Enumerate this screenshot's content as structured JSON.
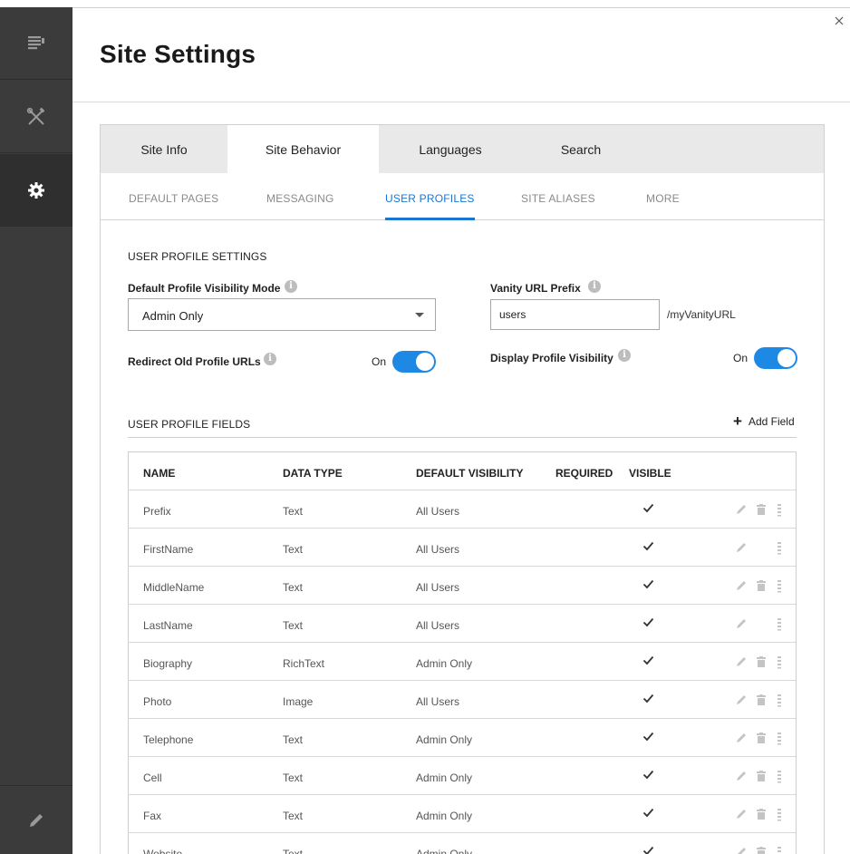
{
  "page": {
    "title": "Site Settings"
  },
  "rail": {
    "items": [
      {
        "icon": "pages-icon"
      },
      {
        "icon": "tools-icon"
      },
      {
        "icon": "gear-icon",
        "active": true
      }
    ],
    "bottom_icon": "pencil-icon"
  },
  "tabs": [
    {
      "label": "Site Info"
    },
    {
      "label": "Site Behavior",
      "active": true
    },
    {
      "label": "Languages"
    },
    {
      "label": "Search"
    }
  ],
  "subtabs": [
    {
      "label": "DEFAULT PAGES"
    },
    {
      "label": "MESSAGING"
    },
    {
      "label": "USER PROFILES",
      "active": true
    },
    {
      "label": "SITE ALIASES"
    },
    {
      "label": "MORE"
    }
  ],
  "settings": {
    "section_title": "USER PROFILE SETTINGS",
    "visibility_mode_label": "Default Profile Visibility Mode",
    "visibility_mode_value": "Admin Only",
    "vanity_label": "Vanity URL Prefix",
    "vanity_value": "users",
    "vanity_suffix": "/myVanityURL",
    "redirect_label": "Redirect Old Profile URLs",
    "redirect_state": "On",
    "display_label": "Display Profile Visibility",
    "display_state": "On"
  },
  "fields": {
    "section_title": "USER PROFILE FIELDS",
    "add_label": "Add Field",
    "columns": {
      "name": "NAME",
      "type": "DATA TYPE",
      "visibility": "DEFAULT VISIBILITY",
      "required": "REQUIRED",
      "visible": "VISIBLE"
    },
    "rows": [
      {
        "name": "Prefix",
        "type": "Text",
        "visibility": "All Users",
        "visible": true,
        "deletable": true
      },
      {
        "name": "FirstName",
        "type": "Text",
        "visibility": "All Users",
        "visible": true,
        "deletable": false
      },
      {
        "name": "MiddleName",
        "type": "Text",
        "visibility": "All Users",
        "visible": true,
        "deletable": true
      },
      {
        "name": "LastName",
        "type": "Text",
        "visibility": "All Users",
        "visible": true,
        "deletable": false
      },
      {
        "name": "Biography",
        "type": "RichText",
        "visibility": "Admin Only",
        "visible": true,
        "deletable": true
      },
      {
        "name": "Photo",
        "type": "Image",
        "visibility": "All Users",
        "visible": true,
        "deletable": true
      },
      {
        "name": "Telephone",
        "type": "Text",
        "visibility": "Admin Only",
        "visible": true,
        "deletable": true
      },
      {
        "name": "Cell",
        "type": "Text",
        "visibility": "Admin Only",
        "visible": true,
        "deletable": true
      },
      {
        "name": "Fax",
        "type": "Text",
        "visibility": "Admin Only",
        "visible": true,
        "deletable": true
      },
      {
        "name": "Website",
        "type": "Text",
        "visibility": "Admin Only",
        "visible": true,
        "deletable": true
      }
    ]
  },
  "colors": {
    "accent": "#1976d2",
    "rail": "#3b3b3b",
    "toggle_on": "#1e88e5"
  }
}
